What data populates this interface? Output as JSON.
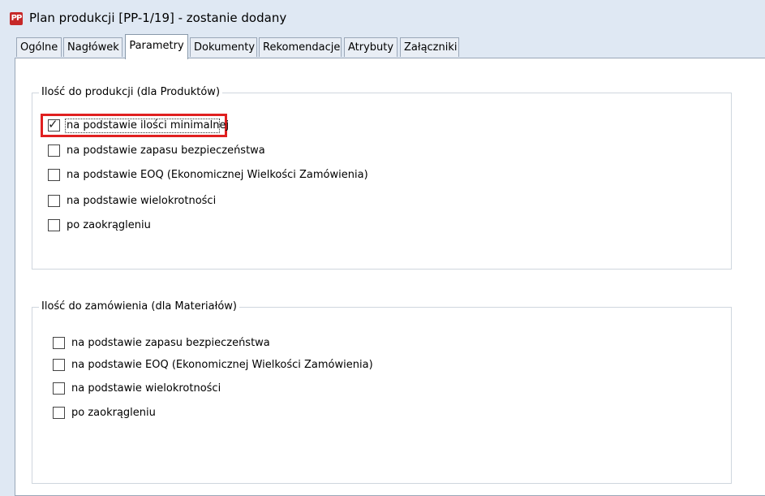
{
  "window": {
    "icon_label": "PP",
    "title": "Plan produkcji [PP-1/19] - zostanie dodany"
  },
  "tabs": [
    {
      "label": "Ogólne",
      "active": false
    },
    {
      "label": "Nagłówek",
      "active": false
    },
    {
      "label": "Parametry",
      "active": true
    },
    {
      "label": "Dokumenty",
      "active": false
    },
    {
      "label": "Rekomendacje",
      "active": false
    },
    {
      "label": "Atrybuty",
      "active": false
    },
    {
      "label": "Załączniki",
      "active": false
    }
  ],
  "group_products": {
    "legend": "Ilość do produkcji (dla Produktów)",
    "options": [
      {
        "label": "na podstawie ilości minimalnej",
        "checked": true
      },
      {
        "label": "na podstawie zapasu bezpieczeństwa",
        "checked": false
      },
      {
        "label": "na podstawie EOQ (Ekonomicznej Wielkości Zamówienia)",
        "checked": false
      },
      {
        "label": "na podstawie wielokrotności",
        "checked": false
      },
      {
        "label": "po zaokrągleniu",
        "checked": false
      }
    ]
  },
  "group_materials": {
    "legend": "Ilość do zamówienia (dla Materiałów)",
    "options": [
      {
        "label": "na podstawie zapasu bezpieczeństwa",
        "checked": false
      },
      {
        "label": "na podstawie EOQ (Ekonomicznej Wielkości Zamówienia)",
        "checked": false
      },
      {
        "label": "na podstawie wielokrotności",
        "checked": false
      },
      {
        "label": "po zaokrągleniu",
        "checked": false
      }
    ]
  },
  "check_glyph": "✓",
  "colors": {
    "highlight": "#e02020",
    "window_bg": "#dfe8f3",
    "panel_bg": "#ffffff"
  }
}
